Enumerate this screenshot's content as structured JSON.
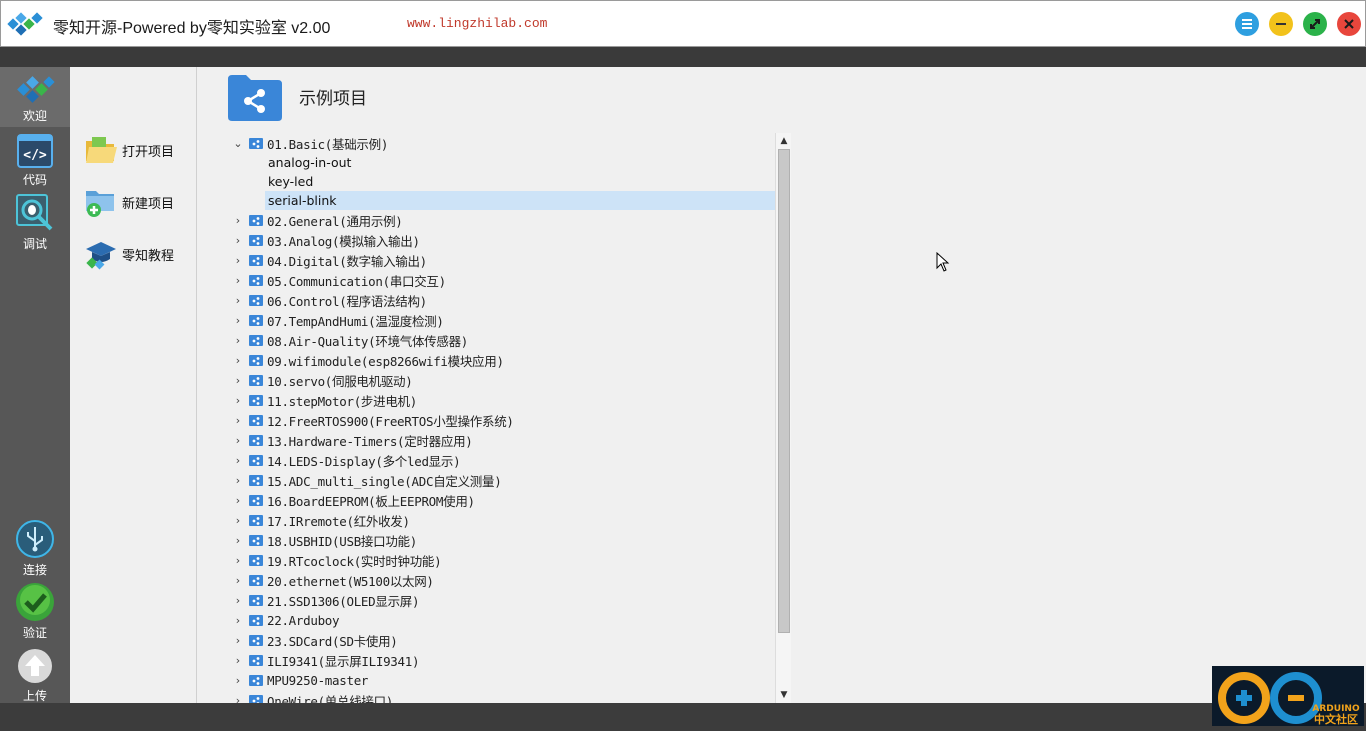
{
  "titlebar": {
    "app_title": "零知开源-Powered by零知实验室 v2.00",
    "url": "www.lingzhilab.com"
  },
  "rail": {
    "items": [
      {
        "label": "欢迎",
        "icon": "diamond-logo-icon"
      },
      {
        "label": "代码",
        "icon": "code-icon"
      },
      {
        "label": "调试",
        "icon": "debug-bug-icon"
      },
      {
        "label": "连接",
        "icon": "usb-icon"
      },
      {
        "label": "验证",
        "icon": "checkmark-icon"
      },
      {
        "label": "上传",
        "icon": "upload-arrow-icon"
      }
    ]
  },
  "panel": {
    "items": [
      {
        "label": "打开项目",
        "icon": "open-folder-icon"
      },
      {
        "label": "新建项目",
        "icon": "new-folder-icon"
      },
      {
        "label": "零知教程",
        "icon": "tutorial-cap-icon"
      }
    ]
  },
  "main": {
    "title": "示例项目",
    "tree": [
      {
        "label": "01.Basic(基础示例)",
        "expanded": true,
        "children": [
          "analog-in-out",
          "key-led",
          "serial-blink"
        ],
        "selected_child": 2
      },
      {
        "label": "02.General(通用示例)"
      },
      {
        "label": "03.Analog(模拟输入输出)"
      },
      {
        "label": "04.Digital(数字输入输出)"
      },
      {
        "label": "05.Communication(串口交互)"
      },
      {
        "label": "06.Control(程序语法结构)"
      },
      {
        "label": "07.TempAndHumi(温湿度检测)"
      },
      {
        "label": "08.Air-Quality(环境气体传感器)"
      },
      {
        "label": "09.wifimodule(esp8266wifi模块应用)"
      },
      {
        "label": "10.servo(伺服电机驱动)"
      },
      {
        "label": "11.stepMotor(步进电机)"
      },
      {
        "label": "12.FreeRTOS900(FreeRTOS小型操作系统)"
      },
      {
        "label": "13.Hardware-Timers(定时器应用)"
      },
      {
        "label": "14.LEDS-Display(多个led显示)"
      },
      {
        "label": "15.ADC_multi_single(ADC自定义测量)"
      },
      {
        "label": "16.BoardEEPROM(板上EEPROM使用)"
      },
      {
        "label": "17.IRremote(红外收发)"
      },
      {
        "label": "18.USBHID(USB接口功能)"
      },
      {
        "label": "19.RTcoclock(实时时钟功能)"
      },
      {
        "label": "20.ethernet(W5100以太网)"
      },
      {
        "label": "21.SSD1306(OLED显示屏)"
      },
      {
        "label": "22.Arduboy"
      },
      {
        "label": "23.SDCard(SD卡使用)"
      },
      {
        "label": "ILI9341(显示屏ILI9341)"
      },
      {
        "label": "MPU9250-master"
      },
      {
        "label": "OneWire(单总线接口)"
      }
    ]
  },
  "badge": {
    "text_top": "ARDUINO",
    "text_bottom": "中文社区"
  },
  "colors": {
    "accent_blue": "#2e7bd6",
    "selection": "#cde3f7",
    "url_red": "#c0392b",
    "rail_bg": "#575757"
  }
}
